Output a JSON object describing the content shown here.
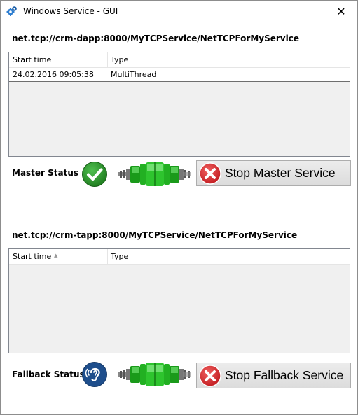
{
  "window": {
    "title": "Windows Service - GUI",
    "close_symbol": "✕",
    "icon": "gear-icon"
  },
  "master": {
    "endpoint": "net.tcp://crm-dapp:8000/MyTCPService/NetTCPForMyService",
    "columns": [
      "Start time",
      "Type"
    ],
    "rows": [
      {
        "start_time": "24.02.2016 09:05:38",
        "type": "MultiThread"
      }
    ],
    "status_label": "Master Status",
    "status_icon": "checkmark-icon",
    "status_color": "#2d8a2d",
    "connection_icon": "connector-icon",
    "button_label": "Stop Master Service",
    "button_icon": "stop-icon"
  },
  "fallback": {
    "endpoint": "net.tcp://crm-tapp:8000/MyTCPService/NetTCPForMyService",
    "columns": [
      "Start time",
      "Type"
    ],
    "rows": [],
    "sort_indicator": "▲",
    "status_label": "Fallback Status",
    "status_icon": "ear-icon",
    "status_color": "#1e4e8c",
    "connection_icon": "connector-icon",
    "button_label": "Stop Fallback Service",
    "button_icon": "stop-icon"
  },
  "colors": {
    "connector_green": "#22b022",
    "stop_red": "#d9262a"
  }
}
